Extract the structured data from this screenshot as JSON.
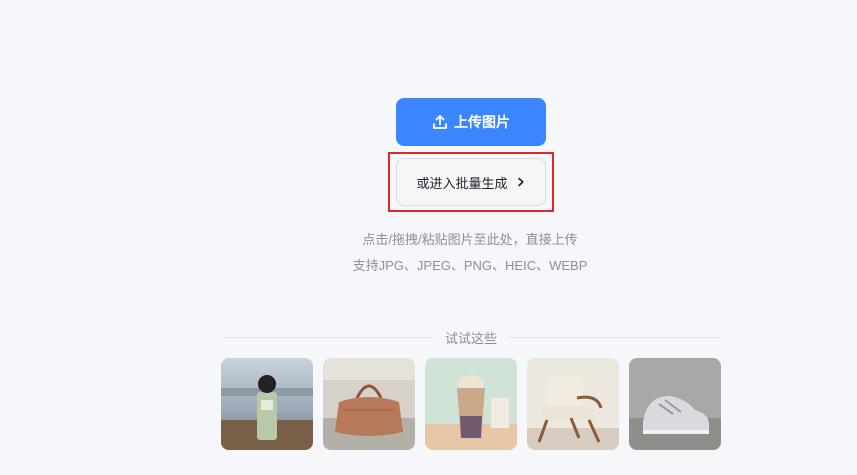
{
  "upload": {
    "label": "上传图片",
    "icon": "upload-icon"
  },
  "batch": {
    "label": "或进入批量生成",
    "icon": "chevron-right-icon"
  },
  "hints": {
    "line1": "点击/拖拽/粘贴图片至此处，直接上传",
    "line2": "支持JPG、JPEG、PNG、HEIC、WEBP"
  },
  "samples": {
    "title": "试试这些",
    "items": [
      {
        "label": "perfume"
      },
      {
        "label": "handbag"
      },
      {
        "label": "drink"
      },
      {
        "label": "armchair"
      },
      {
        "label": "sneaker"
      }
    ]
  },
  "colors": {
    "primary": "#3b86ff",
    "highlight": "#e0262b"
  }
}
